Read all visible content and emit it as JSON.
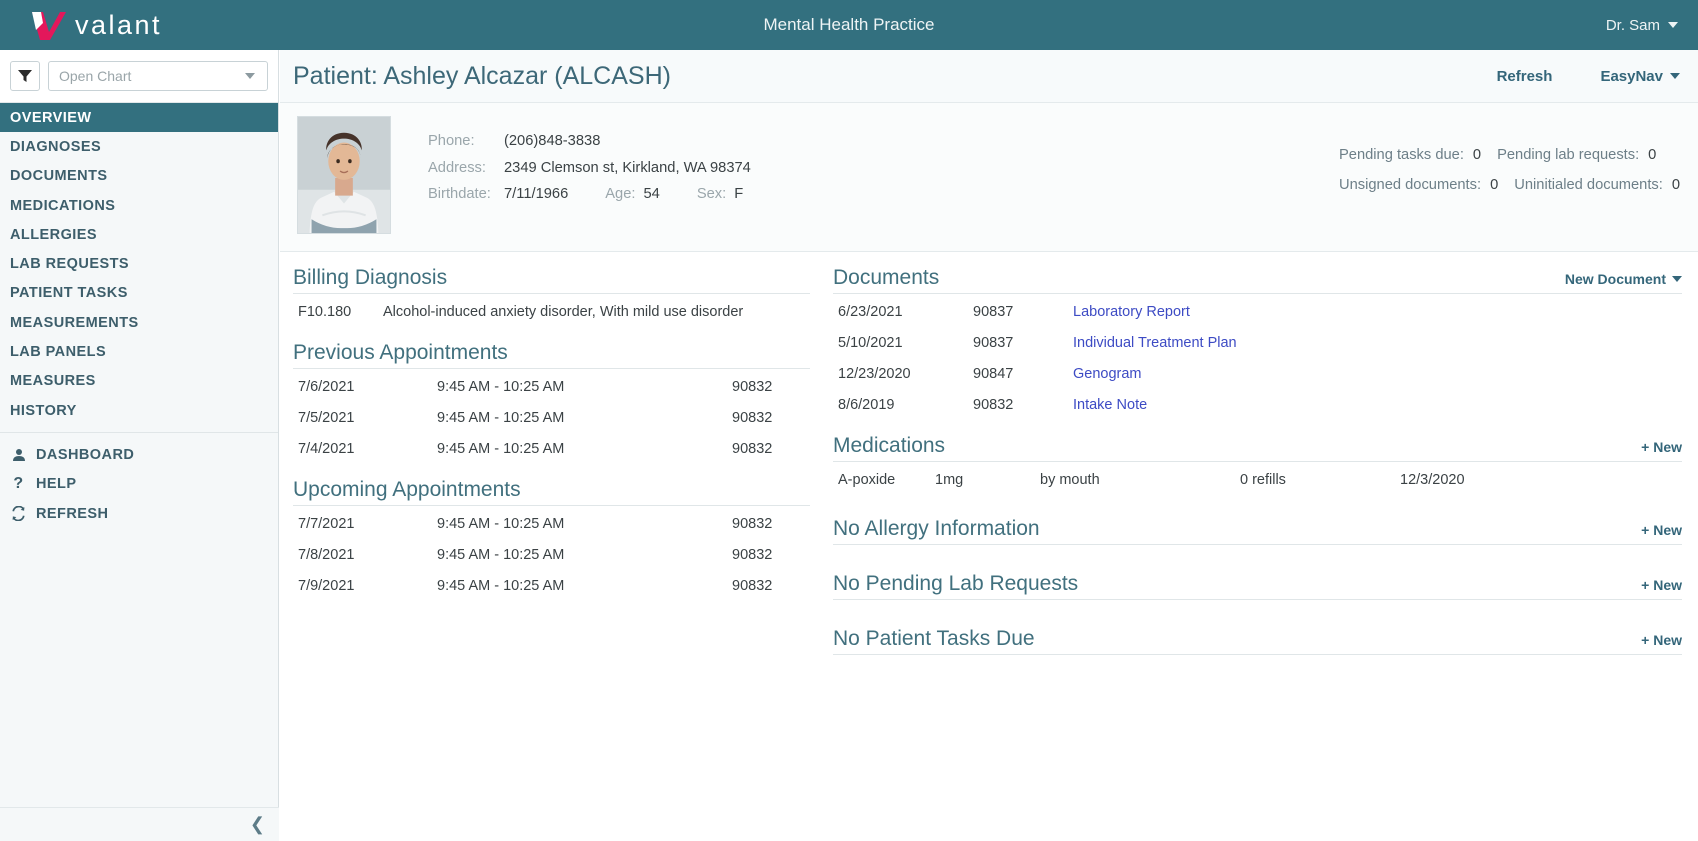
{
  "brand": {
    "name": "valant",
    "logo_icon": "valant-checkmark-logo",
    "primary_color": "#33707f",
    "accent_color": "#e3175b"
  },
  "topbar": {
    "app_title": "Mental Health Practice",
    "user_name": "Dr. Sam",
    "user_caret_icon": "chevron-down-icon"
  },
  "sidebar": {
    "filter_icon": "filter-funnel-icon",
    "chart_select": {
      "placeholder": "Open Chart",
      "value": "Open Chart",
      "caret_icon": "chevron-down-icon"
    },
    "nav_items": [
      {
        "label": "OVERVIEW",
        "active": true
      },
      {
        "label": "DIAGNOSES",
        "active": false
      },
      {
        "label": "DOCUMENTS",
        "active": false
      },
      {
        "label": "MEDICATIONS",
        "active": false
      },
      {
        "label": "ALLERGIES",
        "active": false
      },
      {
        "label": "LAB REQUESTS",
        "active": false
      },
      {
        "label": "PATIENT TASKS",
        "active": false
      },
      {
        "label": "MEASUREMENTS",
        "active": false
      },
      {
        "label": "LAB PANELS",
        "active": false
      },
      {
        "label": "MEASURES",
        "active": false
      },
      {
        "label": "HISTORY",
        "active": false
      }
    ],
    "utility_items": [
      {
        "label": "DASHBOARD",
        "icon": "user-person-icon"
      },
      {
        "label": "HELP",
        "icon": "question-mark-icon"
      },
      {
        "label": "REFRESH",
        "icon": "refresh-circular-arrows-icon"
      }
    ],
    "collapse_icon": "chevron-left-icon"
  },
  "patient_header": {
    "title": "Patient: Ashley Alcazar (ALCASH)",
    "refresh_label": "Refresh",
    "easynav_label": "EasyNav",
    "easynav_caret_icon": "chevron-down-icon"
  },
  "demographics": {
    "avatar_icon": "patient-photo",
    "phone_label": "Phone:",
    "phone_value": "(206)848-3838",
    "address_label": "Address:",
    "address_value": "2349 Clemson st, Kirkland, WA 98374",
    "birthdate_label": "Birthdate:",
    "birthdate_value": "7/11/1966",
    "age_label": "Age:",
    "age_value": "54",
    "sex_label": "Sex:",
    "sex_value": "F"
  },
  "counters": {
    "pending_tasks_label": "Pending tasks due:",
    "pending_tasks_value": "0",
    "pending_labs_label": "Pending lab requests:",
    "pending_labs_value": "0",
    "unsigned_docs_label": "Unsigned documents:",
    "unsigned_docs_value": "0",
    "uninitialed_docs_label": "Uninitialed documents:",
    "uninitialed_docs_value": "0"
  },
  "billing_diagnosis": {
    "title": "Billing Diagnosis",
    "rows": [
      {
        "code": "F10.180",
        "description": "Alcohol-induced anxiety disorder, With mild use disorder"
      }
    ]
  },
  "previous_appointments": {
    "title": "Previous Appointments",
    "rows": [
      {
        "date": "7/6/2021",
        "time": "9:45 AM - 10:25 AM",
        "code": "90832"
      },
      {
        "date": "7/5/2021",
        "time": "9:45 AM - 10:25 AM",
        "code": "90832"
      },
      {
        "date": "7/4/2021",
        "time": "9:45 AM - 10:25 AM",
        "code": "90832"
      }
    ]
  },
  "upcoming_appointments": {
    "title": "Upcoming Appointments",
    "rows": [
      {
        "date": "7/7/2021",
        "time": "9:45 AM - 10:25 AM",
        "code": "90832"
      },
      {
        "date": "7/8/2021",
        "time": "9:45 AM - 10:25 AM",
        "code": "90832"
      },
      {
        "date": "7/9/2021",
        "time": "9:45 AM - 10:25 AM",
        "code": "90832"
      }
    ]
  },
  "documents": {
    "title": "Documents",
    "action_label": "New Document",
    "action_caret_icon": "chevron-down-icon",
    "rows": [
      {
        "date": "6/23/2021",
        "code": "90837",
        "name": "Laboratory Report"
      },
      {
        "date": "5/10/2021",
        "code": "90837",
        "name": "Individual Treatment Plan"
      },
      {
        "date": "12/23/2020",
        "code": "90847",
        "name": "Genogram"
      },
      {
        "date": "8/6/2019",
        "code": "90832",
        "name": "Intake Note"
      }
    ]
  },
  "medications": {
    "title": "Medications",
    "action_label": "+ New",
    "rows": [
      {
        "name": "A-poxide",
        "dose": "1mg",
        "route": "by mouth",
        "refills": "0 refills",
        "date": "12/3/2020"
      }
    ]
  },
  "allergies": {
    "title": "No Allergy Information",
    "action_label": "+ New"
  },
  "lab_requests": {
    "title": "No Pending Lab Requests",
    "action_label": "+ New"
  },
  "patient_tasks": {
    "title": "No Patient Tasks Due",
    "action_label": "+ New"
  }
}
